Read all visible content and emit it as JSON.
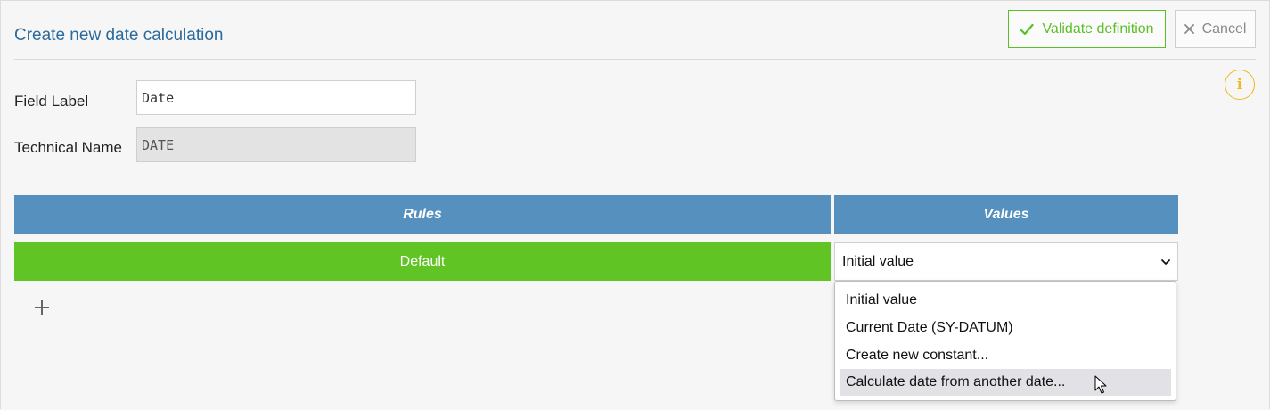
{
  "header": {
    "title": "Create new date calculation",
    "validate_label": "Validate definition",
    "cancel_label": "Cancel"
  },
  "form": {
    "field_label": {
      "label": "Field Label",
      "value": "Date"
    },
    "technical_name": {
      "label": "Technical Name",
      "value": "DATE"
    }
  },
  "table": {
    "columns": [
      "Rules",
      "Values"
    ],
    "rows": [
      {
        "rule": "Default",
        "value": "Initial value"
      }
    ]
  },
  "dropdown": {
    "options": [
      "Initial value",
      "Current Date (SY-DATUM)",
      "Create new constant...",
      "Calculate date from another date..."
    ],
    "hovered_index": 3
  },
  "icons": {
    "validate": "check-icon",
    "cancel": "close-icon",
    "info": "info-icon",
    "add": "plus-icon",
    "select": "chevron-down-icon"
  },
  "colors": {
    "title": "#2b6a9c",
    "header_bg": "#5590bf",
    "rule_bg": "#5fc424",
    "validate": "#5bbf2a",
    "info": "#f0b81c"
  }
}
